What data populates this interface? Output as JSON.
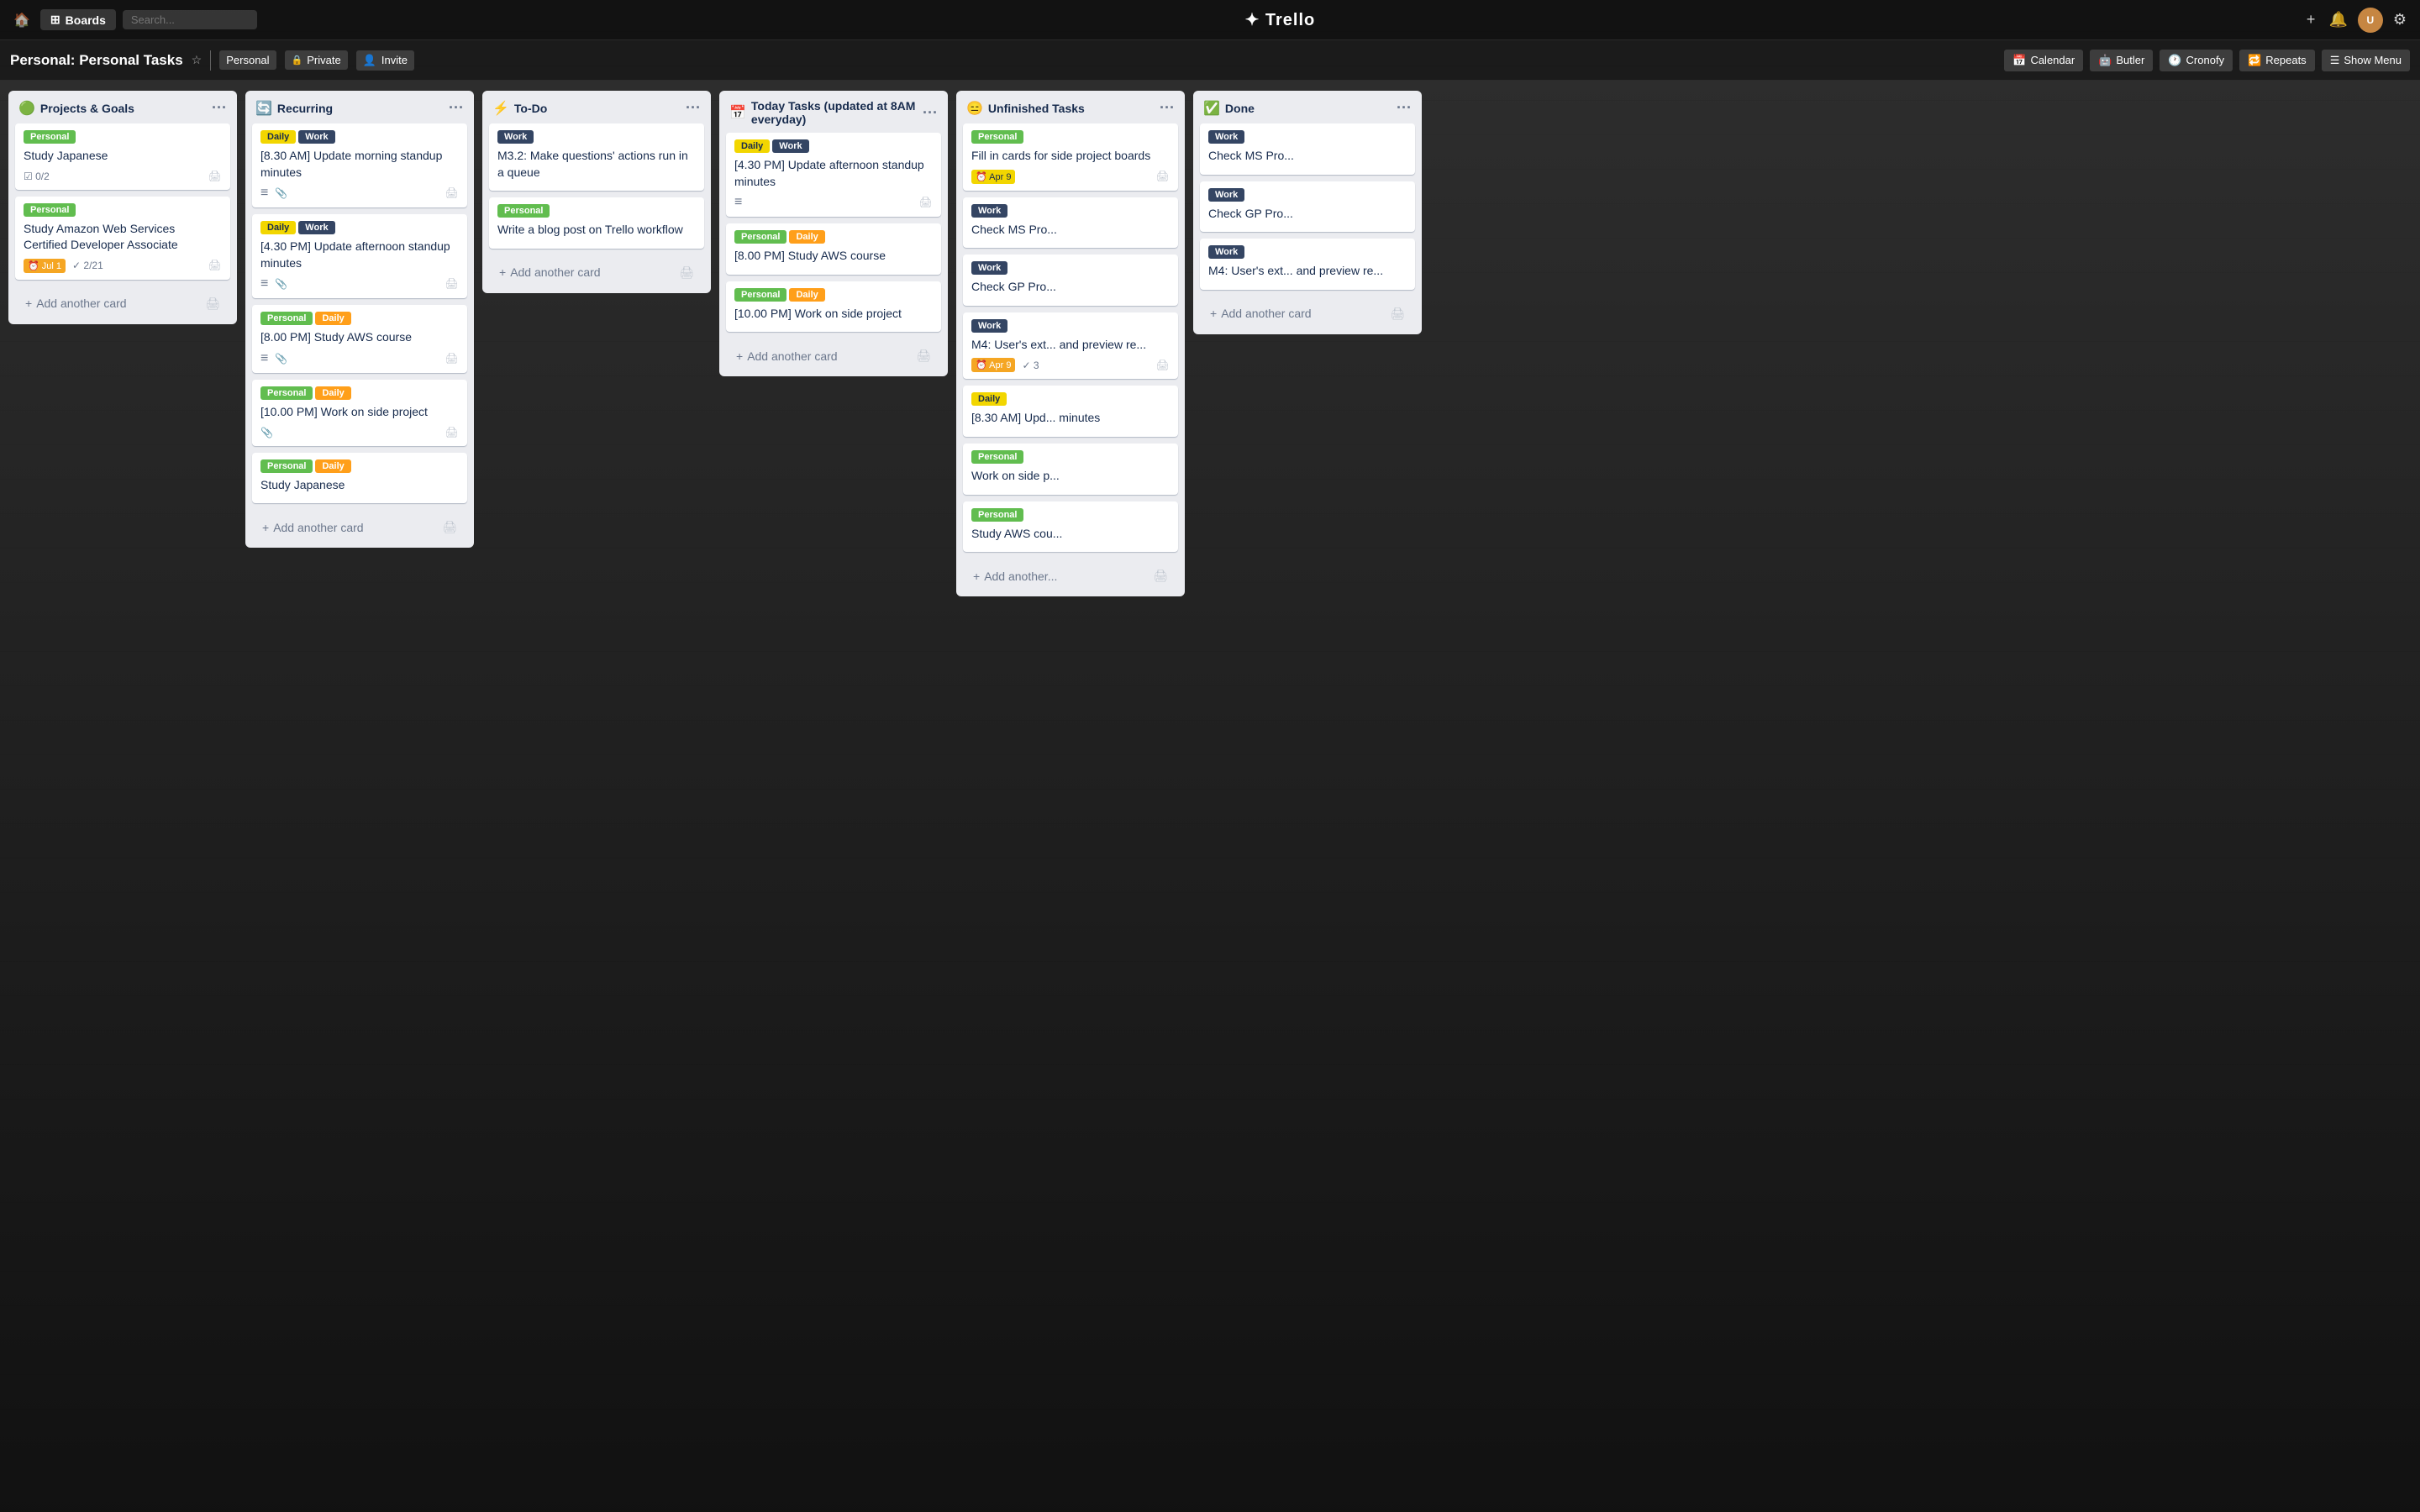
{
  "topnav": {
    "boards_label": "Boards",
    "search_placeholder": "Search...",
    "logo": "✦ Trello",
    "bell_icon": "🔔",
    "settings_icon": "⚙",
    "add_icon": "+"
  },
  "board_header": {
    "title": "Personal: Personal Tasks",
    "visibility": "Personal",
    "privacy": "Private",
    "invite": "Invite",
    "calendar": "Calendar",
    "butler": "Butler",
    "cronofy": "Cronofy",
    "repeats": "Repeats",
    "show_menu": "Show Menu"
  },
  "lists": [
    {
      "id": "projects",
      "icon": "🟢",
      "title": "Projects & Goals",
      "cards": [
        {
          "id": "c1",
          "labels": [
            {
              "text": "Personal",
              "color": "green"
            }
          ],
          "title": "Study Japanese",
          "checklist": "0/2"
        },
        {
          "id": "c2",
          "labels": [
            {
              "text": "Personal",
              "color": "green"
            }
          ],
          "title": "Study Amazon Web Services Certified Developer Associate",
          "due": "Jul 1",
          "progress": "2/21"
        }
      ],
      "add_card": "Add another card"
    },
    {
      "id": "recurring",
      "icon": "🔄",
      "title": "Recurring",
      "cards": [
        {
          "id": "r1",
          "labels": [
            {
              "text": "Daily",
              "color": "yellow"
            },
            {
              "text": "Work",
              "color": "dark"
            }
          ],
          "title": "[8.30 AM] Update morning standup minutes",
          "has_desc": true,
          "has_attach": true
        },
        {
          "id": "r2",
          "labels": [
            {
              "text": "Daily",
              "color": "yellow"
            },
            {
              "text": "Work",
              "color": "dark"
            }
          ],
          "title": "[4.30 PM] Update afternoon standup minutes",
          "has_desc": true,
          "has_attach": true
        },
        {
          "id": "r3",
          "labels": [
            {
              "text": "Personal",
              "color": "green"
            },
            {
              "text": "Daily",
              "color": "orange"
            }
          ],
          "title": "[8.00 PM] Study AWS course",
          "has_desc": true,
          "has_attach": true
        },
        {
          "id": "r4",
          "labels": [
            {
              "text": "Personal",
              "color": "green"
            },
            {
              "text": "Daily",
              "color": "orange"
            }
          ],
          "title": "[10.00 PM] Work on side project",
          "has_attach": true
        },
        {
          "id": "r5",
          "labels": [
            {
              "text": "Personal",
              "color": "green"
            },
            {
              "text": "Daily",
              "color": "orange"
            }
          ],
          "title": "Study Japanese"
        }
      ],
      "add_card": "Add another card"
    },
    {
      "id": "todo",
      "icon": "⚡",
      "title": "To-Do",
      "cards": [
        {
          "id": "t1",
          "labels": [
            {
              "text": "Work",
              "color": "dark"
            }
          ],
          "title": "M3.2: Make questions' actions run in a queue"
        },
        {
          "id": "t2",
          "labels": [
            {
              "text": "Personal",
              "color": "green"
            }
          ],
          "title": "Write a blog post on Trello workflow"
        }
      ],
      "add_card": "Add another card"
    },
    {
      "id": "today",
      "icon": "📅",
      "title": "Today Tasks (updated at 8AM everyday)",
      "cards": [
        {
          "id": "td1",
          "labels": [
            {
              "text": "Daily",
              "color": "yellow"
            },
            {
              "text": "Work",
              "color": "dark"
            }
          ],
          "title": "[4.30 PM] Update afternoon standup minutes",
          "has_desc": true
        },
        {
          "id": "td2",
          "labels": [
            {
              "text": "Personal",
              "color": "green"
            },
            {
              "text": "Daily",
              "color": "orange"
            }
          ],
          "title": "[8.00 PM] Study AWS course"
        },
        {
          "id": "td3",
          "labels": [
            {
              "text": "Personal",
              "color": "green"
            },
            {
              "text": "Daily",
              "color": "orange"
            }
          ],
          "title": "[10.00 PM] Work on side project"
        }
      ],
      "add_card": "Add another card"
    },
    {
      "id": "unfinished",
      "icon": "😑",
      "title": "Unfinished Tasks",
      "cards": [
        {
          "id": "u1",
          "labels": [
            {
              "text": "Personal",
              "color": "green"
            }
          ],
          "title": "Fill in cards for side project boards",
          "due": "Apr 9",
          "due_color": "yellow"
        },
        {
          "id": "u2",
          "labels": [
            {
              "text": "Work",
              "color": "dark"
            }
          ],
          "title": "Check MS Pro..."
        },
        {
          "id": "u3",
          "labels": [
            {
              "text": "Work",
              "color": "dark"
            }
          ],
          "title": "Check GP Pro..."
        },
        {
          "id": "u4",
          "labels": [
            {
              "text": "Work",
              "color": "dark"
            }
          ],
          "title": "M4: User's ext... and preview re...",
          "due": "Apr 9",
          "progress": "3"
        },
        {
          "id": "u5",
          "labels": [
            {
              "text": "Daily",
              "color": "yellow"
            }
          ],
          "title": "[8.30 AM] Upd... minutes"
        },
        {
          "id": "u6",
          "labels": [
            {
              "text": "Personal",
              "color": "green"
            }
          ],
          "title": "Work on side p..."
        },
        {
          "id": "u7",
          "labels": [
            {
              "text": "Personal",
              "color": "green"
            }
          ],
          "title": "Study AWS cou..."
        }
      ],
      "add_card": "Add another..."
    },
    {
      "id": "done",
      "icon": "✅",
      "title": "Done",
      "cards": [
        {
          "id": "d1",
          "labels": [
            {
              "text": "Work",
              "color": "dark"
            }
          ],
          "title": "Check MS Pro..."
        },
        {
          "id": "d2",
          "labels": [
            {
              "text": "Work",
              "color": "dark"
            }
          ],
          "title": "Check GP Pro..."
        },
        {
          "id": "d3",
          "labels": [
            {
              "text": "Work",
              "color": "dark"
            }
          ],
          "title": "M4: User's ext... and preview re..."
        }
      ],
      "add_card": "Add another card"
    }
  ],
  "colors": {
    "green": "#61bd4f",
    "yellow": "#f2d600",
    "orange": "#ff9f1a",
    "dark": "#344563",
    "blue": "#0079bf"
  }
}
